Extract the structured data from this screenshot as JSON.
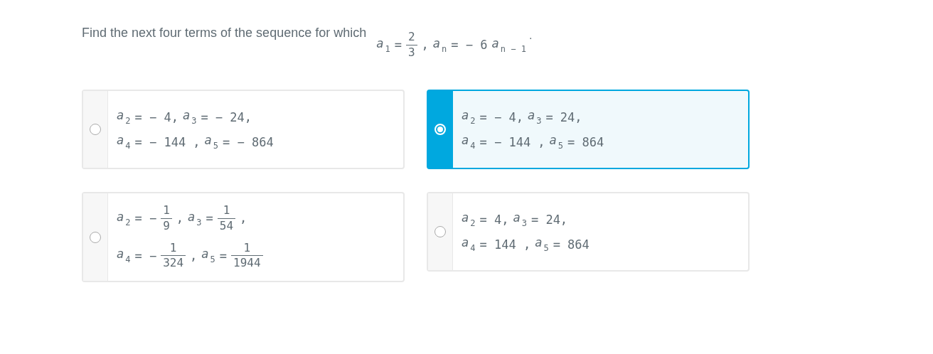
{
  "question": {
    "text": "Find the next four terms of the sequence for which",
    "formula": [
      {
        "kind": "var",
        "name": "a",
        "sub": "1"
      },
      {
        "kind": "text",
        "text": "="
      },
      {
        "kind": "frac",
        "num": "2",
        "den": "3"
      },
      {
        "kind": "text",
        "text": ","
      },
      {
        "kind": "var",
        "name": "a",
        "sub": "n"
      },
      {
        "kind": "text",
        "text": "= − 6"
      },
      {
        "kind": "var",
        "name": "a",
        "sub": "n − 1"
      }
    ],
    "end": "."
  },
  "options": [
    {
      "selected": false,
      "lines": [
        [
          {
            "kind": "var",
            "name": "a",
            "sub": "2"
          },
          {
            "kind": "text",
            "text": "= − 4,"
          },
          {
            "kind": "var",
            "name": "a",
            "sub": "3"
          },
          {
            "kind": "text",
            "text": "= − 24,"
          }
        ],
        [
          {
            "kind": "var",
            "name": "a",
            "sub": "4"
          },
          {
            "kind": "text",
            "text": "= − 144 ,"
          },
          {
            "kind": "var",
            "name": "a",
            "sub": "5"
          },
          {
            "kind": "text",
            "text": "= − 864"
          }
        ]
      ]
    },
    {
      "selected": true,
      "lines": [
        [
          {
            "kind": "var",
            "name": "a",
            "sub": "2"
          },
          {
            "kind": "text",
            "text": "= − 4,"
          },
          {
            "kind": "var",
            "name": "a",
            "sub": "3"
          },
          {
            "kind": "text",
            "text": "= 24,"
          }
        ],
        [
          {
            "kind": "var",
            "name": "a",
            "sub": "4"
          },
          {
            "kind": "text",
            "text": "= − 144 ,"
          },
          {
            "kind": "var",
            "name": "a",
            "sub": "5"
          },
          {
            "kind": "text",
            "text": "= 864"
          }
        ]
      ]
    },
    {
      "selected": false,
      "lines": [
        [
          {
            "kind": "var",
            "name": "a",
            "sub": "2"
          },
          {
            "kind": "text",
            "text": "= −"
          },
          {
            "kind": "frac",
            "num": "1",
            "den": "9"
          },
          {
            "kind": "text",
            "text": ","
          },
          {
            "kind": "var",
            "name": "a",
            "sub": "3"
          },
          {
            "kind": "text",
            "text": "="
          },
          {
            "kind": "frac",
            "num": "1",
            "den": "54"
          },
          {
            "kind": "text",
            "text": ","
          }
        ],
        [
          {
            "kind": "var",
            "name": "a",
            "sub": "4"
          },
          {
            "kind": "text",
            "text": "= −"
          },
          {
            "kind": "frac",
            "num": "1",
            "den": "324"
          },
          {
            "kind": "text",
            "text": ","
          },
          {
            "kind": "var",
            "name": "a",
            "sub": "5"
          },
          {
            "kind": "text",
            "text": "="
          },
          {
            "kind": "frac",
            "num": "1",
            "den": "1944"
          }
        ]
      ]
    },
    {
      "selected": false,
      "lines": [
        [
          {
            "kind": "var",
            "name": "a",
            "sub": "2"
          },
          {
            "kind": "text",
            "text": "= 4,"
          },
          {
            "kind": "var",
            "name": "a",
            "sub": "3"
          },
          {
            "kind": "text",
            "text": "= 24,"
          }
        ],
        [
          {
            "kind": "var",
            "name": "a",
            "sub": "4"
          },
          {
            "kind": "text",
            "text": "= 144 ,"
          },
          {
            "kind": "var",
            "name": "a",
            "sub": "5"
          },
          {
            "kind": "text",
            "text": "= 864"
          }
        ]
      ]
    }
  ]
}
